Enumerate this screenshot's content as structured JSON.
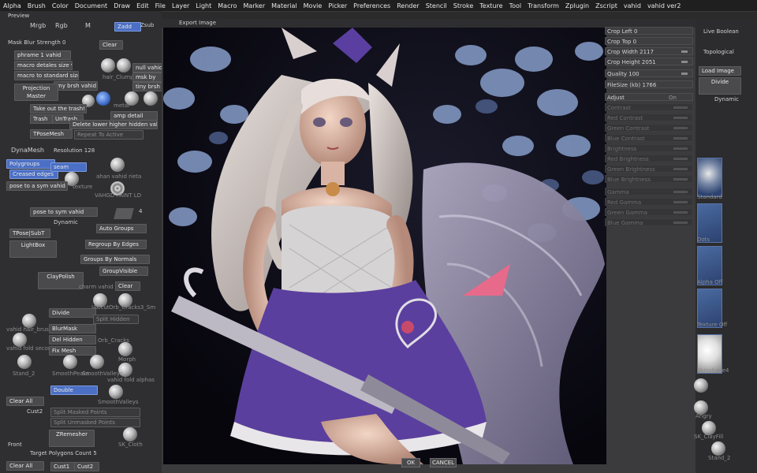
{
  "menu": [
    "Alpha",
    "Brush",
    "Color",
    "Document",
    "Draw",
    "Edit",
    "File",
    "Layer",
    "Light",
    "Macro",
    "Marker",
    "Material",
    "Movie",
    "Picker",
    "Preferences",
    "Render",
    "Stencil",
    "Stroke",
    "Texture",
    "Tool",
    "Transform",
    "Zplugin",
    "Zscript",
    "vahid",
    "vahid ver2"
  ],
  "left": {
    "preview": "Preview",
    "mrgb": "Mrgb",
    "rgb": "Rgb",
    "m": "M",
    "zadd": "Zadd",
    "zsub": "Zsub",
    "mask_blur": "Mask Blur Strength 0",
    "clear": "Clear",
    "phrame": "phrame 1 vahid",
    "macro_details": "macro detales size v",
    "macro_standard": "macro to standard size",
    "brsh_vahid": "my brsh vahid",
    "projection_master": "Projection Master",
    "hair_clump": "hair_Clump",
    "null_vahid": "null vahid",
    "msk_by": "msk by",
    "tiny_brsh": "tiny brsh vahid",
    "metal": "metal",
    "take_out": "Take out the trash!",
    "trash": "Trash",
    "untrash": "UnTrash",
    "amp_detail": "amp detail",
    "del_lower": "Delete lower higher hidden vahid",
    "tposemesh": "TPoseMesh",
    "repeat_to": "Repeat To Active",
    "dynamesh": "DynaMesh",
    "resolution": "Resolution 128",
    "polygroups": "Polygroups",
    "creased_edges": "Creased edges",
    "seam": "seam",
    "ahan": "ahan vahid rieta",
    "pose_sym": "pose to a sym vahid",
    "texture": "texture",
    "vahgd": "VAHGD PAINT LD",
    "pose_to_sym": "pose to sym vahid",
    "four": "4",
    "tpose_subt": "TPose|SubT",
    "dynamic": "Dynamic",
    "auto_groups": "Auto Groups",
    "lightbox": "LightBox",
    "regroup": "Regroup By Edges",
    "groups_normals": "Groups By Normals",
    "group_visible": "GroupVisible",
    "claypolish": "ClayPolish",
    "charm": "charm vahid",
    "clear2": "Clear",
    "divide": "Divide",
    "jacobi": "JACcut",
    "orb_cracks": "Orb_Cracks3_Sm",
    "split_hidden": "Split Hidden",
    "blurmask": "BlurMask",
    "vahid_hair": "vahid hair_brush",
    "del_hidden": "Del Hidden",
    "orb_cracks2": "Orb_Cracks",
    "vahid_fold": "vahid fold secon",
    "fix_mesh": "Fix Mesh",
    "morph": "Morph",
    "stand2": "Stand_2",
    "smoothpeaks": "SmoothPeaks",
    "smoothvalleys": "SmoothValleys",
    "vahid_fold_alpha": "vahid fold alphas",
    "double": "Double",
    "smoothvalleys2": "SmoothValleys",
    "clear_all": "Clear All",
    "cust2": "Cust2",
    "split_masked": "Split Masked Points",
    "split_unmasked": "Split Unmasked Points",
    "front": "Front",
    "zremesher": "ZRemesher",
    "sk_cloth": "SK_Cloth",
    "target_poly": "Target Polygons Count 5",
    "clear_all2": "Clear All",
    "cust1": "Cust1",
    "cust2b": "Cust2"
  },
  "dialog": {
    "title": "Export Image",
    "ok": "OK",
    "cancel": "CANCEL"
  },
  "settings": {
    "crop_left": "Crop Left 0",
    "crop_top": "Crop Top 0",
    "crop_width": "Crop Width 2117",
    "crop_height": "Crop Height 2051",
    "quality": "Quality 100",
    "filesize": "FileSize (kb) 1766",
    "adjust": "Adjust",
    "on": "On",
    "contrast": "Contrast",
    "red_contrast": "Red Contrast",
    "green_contrast": "Green Contrast",
    "blue_contrast": "Blue Contrast",
    "brightness": "Brightness",
    "red_brightness": "Red Brightness",
    "green_brightness": "Green Brightness",
    "blue_brightness": "Blue Brightness",
    "gamma": "Gamma",
    "red_gamma": "Red Gamma",
    "green_gamma": "Green Gamma",
    "blue_gamma": "Blue Gamma"
  },
  "farright": {
    "live_boolean": "Live Boolean",
    "topological": "Topological",
    "load_image": "Load Image",
    "divide": "Divide",
    "dynamic": "Dynamic",
    "standard": "Standard",
    "dots": "Dots",
    "alpha_off": "Alpha Off",
    "texture_off": "Texture Off",
    "material": "Skinshade4",
    "angry": "Angry",
    "sk_clayfill": "SK_ClayFill",
    "stand2": "Stand_2"
  }
}
